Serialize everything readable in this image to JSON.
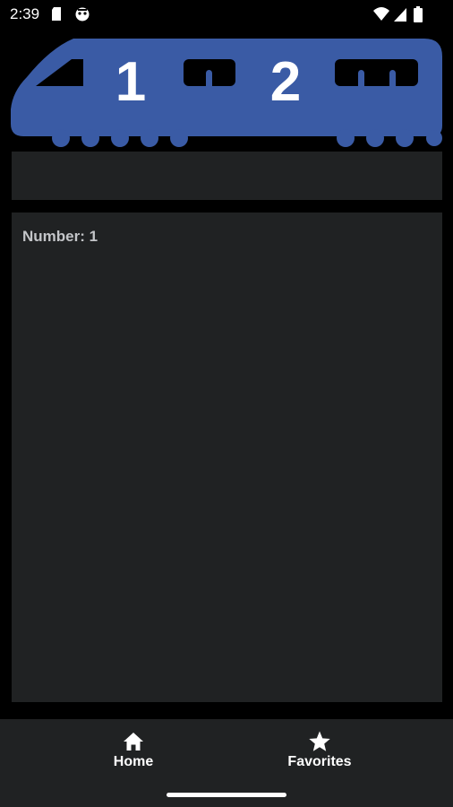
{
  "status_bar": {
    "time": "2:39",
    "left_icons": [
      "sd-card-icon",
      "app-notification-icon"
    ],
    "right_icons": [
      "wifi-icon",
      "cellular-signal-icon",
      "battery-icon"
    ]
  },
  "banner": {
    "car_numbers": [
      "1",
      "2"
    ],
    "train_color": "#3a5ba5"
  },
  "content": {
    "number_text": "Number: 1"
  },
  "bottom_nav": {
    "items": [
      {
        "label": "Home",
        "icon": "home-icon"
      },
      {
        "label": "Favorites",
        "icon": "star-icon"
      }
    ]
  },
  "colors": {
    "background": "#000000",
    "panel": "#202223",
    "text_muted": "#c3c5c8",
    "accent": "#3a5ba5"
  }
}
